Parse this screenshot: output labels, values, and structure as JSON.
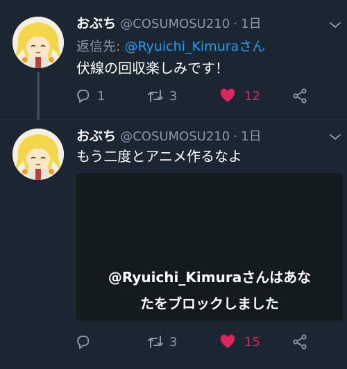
{
  "tweets": [
    {
      "display_name": "おぶち",
      "handle": "@COSUMOSU210",
      "separator": "·",
      "time": "1日",
      "reply_prefix": "返信先:",
      "reply_mention": "@Ryuichi_Kimuraさん",
      "text": "伏線の回収楽しみです！",
      "reply_count": "1",
      "retweet_count": "3",
      "like_count": "12",
      "liked": true
    },
    {
      "display_name": "おぶち",
      "handle": "@COSUMOSU210",
      "separator": "·",
      "time": "1日",
      "text": "もう二度とアニメ作るなよ",
      "media_caption_line1": "@Ryuichi_Kimuraさんはあな",
      "media_caption_line2": "たをブロックしました",
      "reply_count": "",
      "retweet_count": "3",
      "like_count": "15",
      "liked": true
    }
  ],
  "icons": {
    "reply": "speech-bubble-icon",
    "retweet": "retweet-arrows-icon",
    "like": "heart-icon",
    "share": "share-nodes-icon",
    "more": "chevron-down-icon"
  },
  "colors": {
    "background": "#1c2532",
    "secondary_text": "#8899a6",
    "link": "#1da1f2",
    "like": "#e0245e"
  }
}
